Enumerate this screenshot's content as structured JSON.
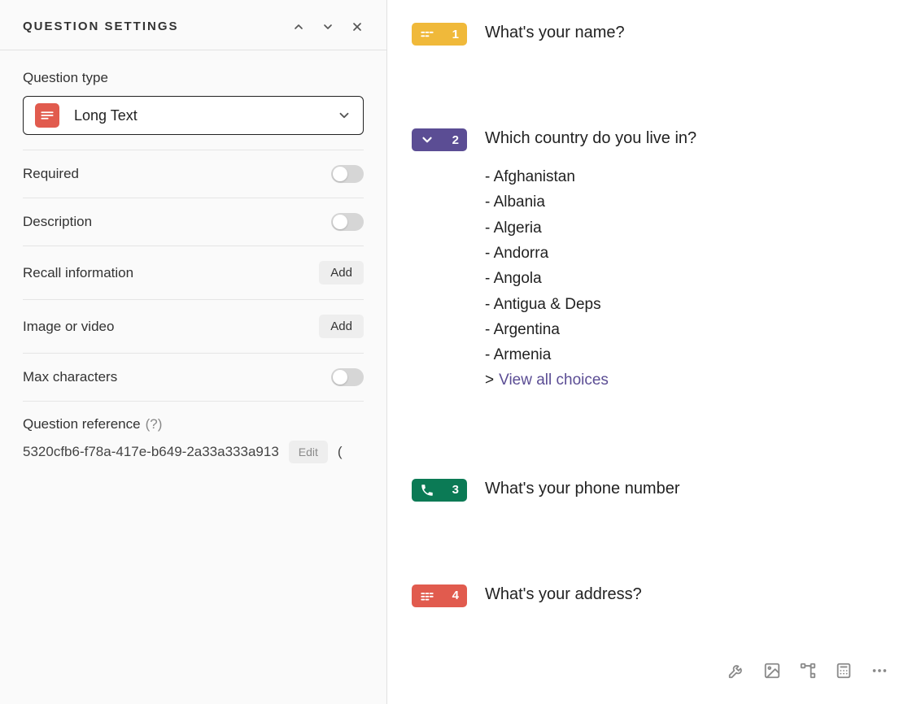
{
  "panel": {
    "title": "QUESTION SETTINGS",
    "question_type": {
      "label": "Question type",
      "selected": "Long Text",
      "icon": "long-text"
    },
    "required": {
      "label": "Required",
      "on": false
    },
    "description": {
      "label": "Description",
      "on": false
    },
    "recall": {
      "label": "Recall information",
      "button": "Add"
    },
    "media": {
      "label": "Image or video",
      "button": "Add"
    },
    "max_chars": {
      "label": "Max characters",
      "on": false
    },
    "reference": {
      "label": "Question reference",
      "hint": "(?)",
      "value": "5320cfb6-f78a-417e-b649-2a33a333a913",
      "edit": "Edit"
    }
  },
  "questions": [
    {
      "num": "1",
      "color": "yellow",
      "icon": "short-text",
      "title": "What's your name?"
    },
    {
      "num": "2",
      "color": "purple",
      "icon": "chevron-down",
      "title": "Which country do you live in?",
      "choices": [
        "Afghanistan",
        "Albania",
        "Algeria",
        "Andorra",
        "Angola",
        "Antigua & Deps",
        "Argentina",
        "Armenia"
      ],
      "view_all": "View all choices"
    },
    {
      "num": "3",
      "color": "green",
      "icon": "phone",
      "title": "What's your phone number"
    },
    {
      "num": "4",
      "color": "red",
      "icon": "long-text",
      "title": "What's your address?"
    }
  ],
  "toolbar": {
    "items": [
      "wrench",
      "image",
      "branch",
      "calculator",
      "more"
    ]
  }
}
